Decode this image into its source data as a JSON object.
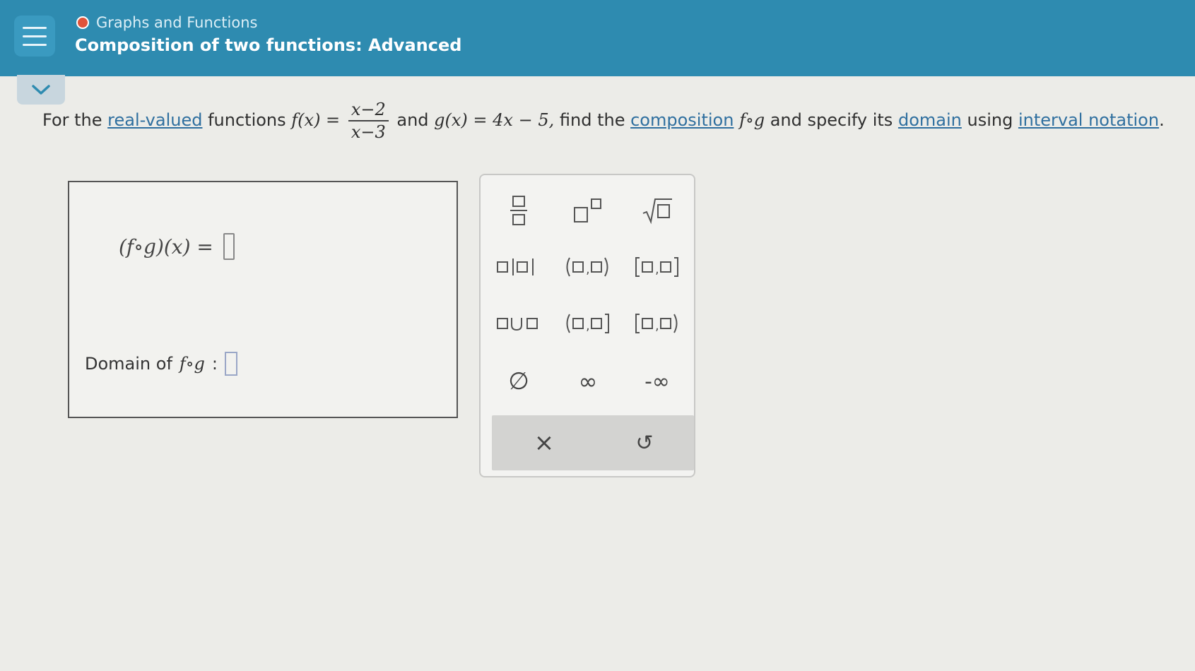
{
  "header": {
    "breadcrumb": "Graphs and Functions",
    "title": "Composition of two functions: Advanced"
  },
  "question": {
    "prefix": "For the",
    "link1": "real-valued",
    "mid1": "functions",
    "f_lhs": "f(x) =",
    "f_num": "x−2",
    "f_den": "x−3",
    "mid2": "and",
    "g_def": "g(x) = 4x − 5,",
    "mid3": "find the",
    "link2": "composition",
    "fog": "f∘g",
    "mid4": "and specify its",
    "link3": "domain",
    "mid5": "using",
    "link4": "interval notation",
    "suffix": "."
  },
  "answer": {
    "fog_label": "(f∘g)(x) =",
    "domain_label": "Domain of",
    "domain_fog": "f∘g",
    "domain_colon": ":"
  },
  "keypad": {
    "keys": [
      {
        "id": "fraction",
        "label": "□/□"
      },
      {
        "id": "exponent",
        "label": "□^□"
      },
      {
        "id": "sqrt",
        "label": "√□"
      },
      {
        "id": "abs",
        "label": "□|□|"
      },
      {
        "id": "open-open",
        "label": "(□,□)"
      },
      {
        "id": "closed-closed",
        "label": "[□,□]"
      },
      {
        "id": "union",
        "label": "□∪□"
      },
      {
        "id": "open-closed",
        "label": "(□,□]"
      },
      {
        "id": "closed-open",
        "label": "[□,□)"
      },
      {
        "id": "empty-set",
        "label": "∅"
      },
      {
        "id": "infinity",
        "label": "∞"
      },
      {
        "id": "neg-infinity",
        "label": "-∞"
      }
    ],
    "clear": "×",
    "undo": "↺"
  },
  "colors": {
    "header_bg": "#2e8bb0",
    "link": "#2f6f9f",
    "page_bg": "#ecece8"
  }
}
